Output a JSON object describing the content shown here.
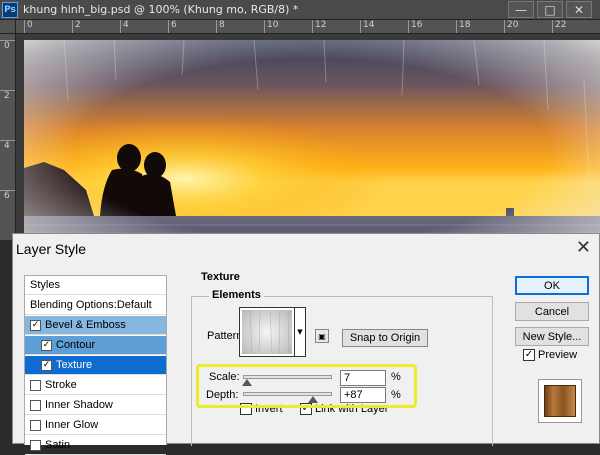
{
  "document": {
    "title": "khung hinh_big.psd @ 100% (Khung mo, RGB/8) *",
    "app_icon": "Ps",
    "ruler_top_ticks": [
      "0",
      "2",
      "4",
      "6",
      "8",
      "10",
      "12",
      "14",
      "16",
      "18",
      "20",
      "22"
    ],
    "ruler_left_ticks": [
      "0",
      "2",
      "4",
      "6"
    ],
    "window_buttons": {
      "minimize": "—",
      "maximize": "□",
      "close": "✕"
    }
  },
  "dialog": {
    "title": "Layer Style",
    "close": "✕",
    "styles_list": [
      {
        "label": "Styles",
        "has_checkbox": false,
        "checked": false,
        "state": "normal",
        "indent": false
      },
      {
        "label": "Blending Options:Default",
        "has_checkbox": false,
        "checked": false,
        "state": "normal",
        "indent": false
      },
      {
        "label": "Bevel & Emboss",
        "has_checkbox": true,
        "checked": true,
        "state": "sel1",
        "indent": false
      },
      {
        "label": "Contour",
        "has_checkbox": true,
        "checked": true,
        "state": "sel2b",
        "indent": true
      },
      {
        "label": "Texture",
        "has_checkbox": true,
        "checked": true,
        "state": "sel2",
        "indent": true
      },
      {
        "label": "Stroke",
        "has_checkbox": true,
        "checked": false,
        "state": "normal",
        "indent": false
      },
      {
        "label": "Inner Shadow",
        "has_checkbox": true,
        "checked": false,
        "state": "normal",
        "indent": false
      },
      {
        "label": "Inner Glow",
        "has_checkbox": true,
        "checked": false,
        "state": "normal",
        "indent": false
      },
      {
        "label": "Satin",
        "has_checkbox": true,
        "checked": false,
        "state": "normal",
        "indent": false
      }
    ],
    "texture": {
      "group_title": "Texture",
      "elements_title": "Elements",
      "pattern_label": "Pattern:",
      "snap_button": "Snap to Origin",
      "scale_label": "Scale:",
      "scale_value": "7",
      "scale_fraction": 0.0,
      "depth_label": "Depth:",
      "depth_value": "+87",
      "depth_fraction": 0.79,
      "percent": "%",
      "invert_label": "Invert",
      "invert_checked": false,
      "link_label": "Link with Layer",
      "link_checked": true
    },
    "buttons": {
      "ok": "OK",
      "cancel": "Cancel",
      "new_style": "New Style...",
      "preview_label": "Preview",
      "preview_checked": true
    }
  }
}
